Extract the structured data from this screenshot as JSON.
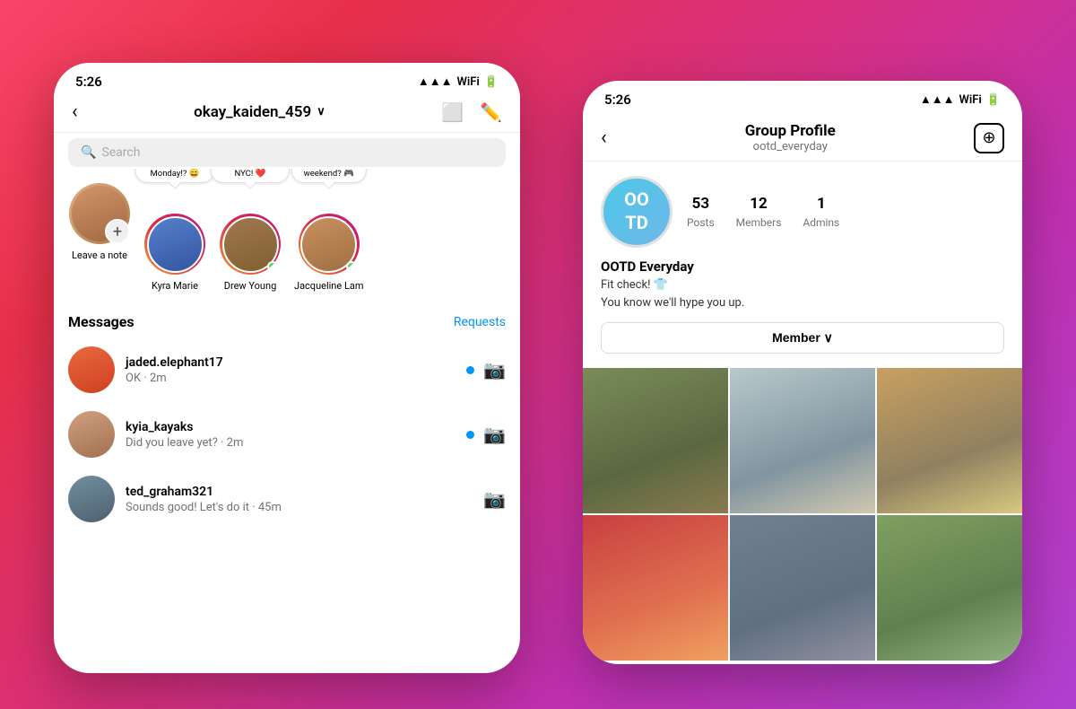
{
  "background": {
    "gradient": "linear-gradient(135deg, #f9456a, #c030b0)"
  },
  "left_phone": {
    "status_bar": {
      "time": "5:26",
      "icons": "signal wifi battery"
    },
    "nav": {
      "back_label": "<",
      "username": "okay_kaiden_459",
      "dropdown_icon": "chevron-down",
      "video_icon": "video-camera",
      "edit_icon": "edit-pencil"
    },
    "search": {
      "placeholder": "Search"
    },
    "stories": [
      {
        "name": "Leave a note",
        "has_add": true,
        "note": null,
        "online": false
      },
      {
        "name": "Kyra Marie",
        "note": "Why is tomorrow Monday!? 😄",
        "online": false
      },
      {
        "name": "Drew Young",
        "note": "Finally landing in NYC! ❤️",
        "online": true
      },
      {
        "name": "Jacqueline Lam",
        "note": "Game night this weekend? 🎮",
        "online": true
      }
    ],
    "messages_section": {
      "title": "Messages",
      "requests_link": "Requests",
      "items": [
        {
          "username": "jaded.elephant17",
          "preview": "OK · 2m",
          "unread": true
        },
        {
          "username": "kyia_kayaks",
          "preview": "Did you leave yet? · 2m",
          "unread": true
        },
        {
          "username": "ted_graham321",
          "preview": "Sounds good! Let's do it · 45m",
          "unread": false
        }
      ]
    }
  },
  "right_phone": {
    "status_bar": {
      "time": "5:26",
      "icons": "signal wifi battery"
    },
    "nav": {
      "back_icon": "back-arrow",
      "title": "Group Profile",
      "add_icon": "add-square"
    },
    "group": {
      "username": "ootd_everyday",
      "avatar_text": "OO\nTD",
      "name": "OOTD Everyday",
      "bio_line1": "Fit check! 👕",
      "bio_line2": "You know we'll hype you up.",
      "stats": {
        "posts": {
          "value": "53",
          "label": "Posts"
        },
        "members": {
          "value": "12",
          "label": "Members"
        },
        "admins": {
          "value": "1",
          "label": "Admins"
        }
      },
      "member_button": "Member ∨",
      "photos": [
        {
          "id": 1,
          "class": "pg1"
        },
        {
          "id": 2,
          "class": "pg2"
        },
        {
          "id": 3,
          "class": "pg3"
        },
        {
          "id": 4,
          "class": "pg4"
        },
        {
          "id": 5,
          "class": "pg5"
        },
        {
          "id": 6,
          "class": "pg6"
        }
      ]
    }
  }
}
